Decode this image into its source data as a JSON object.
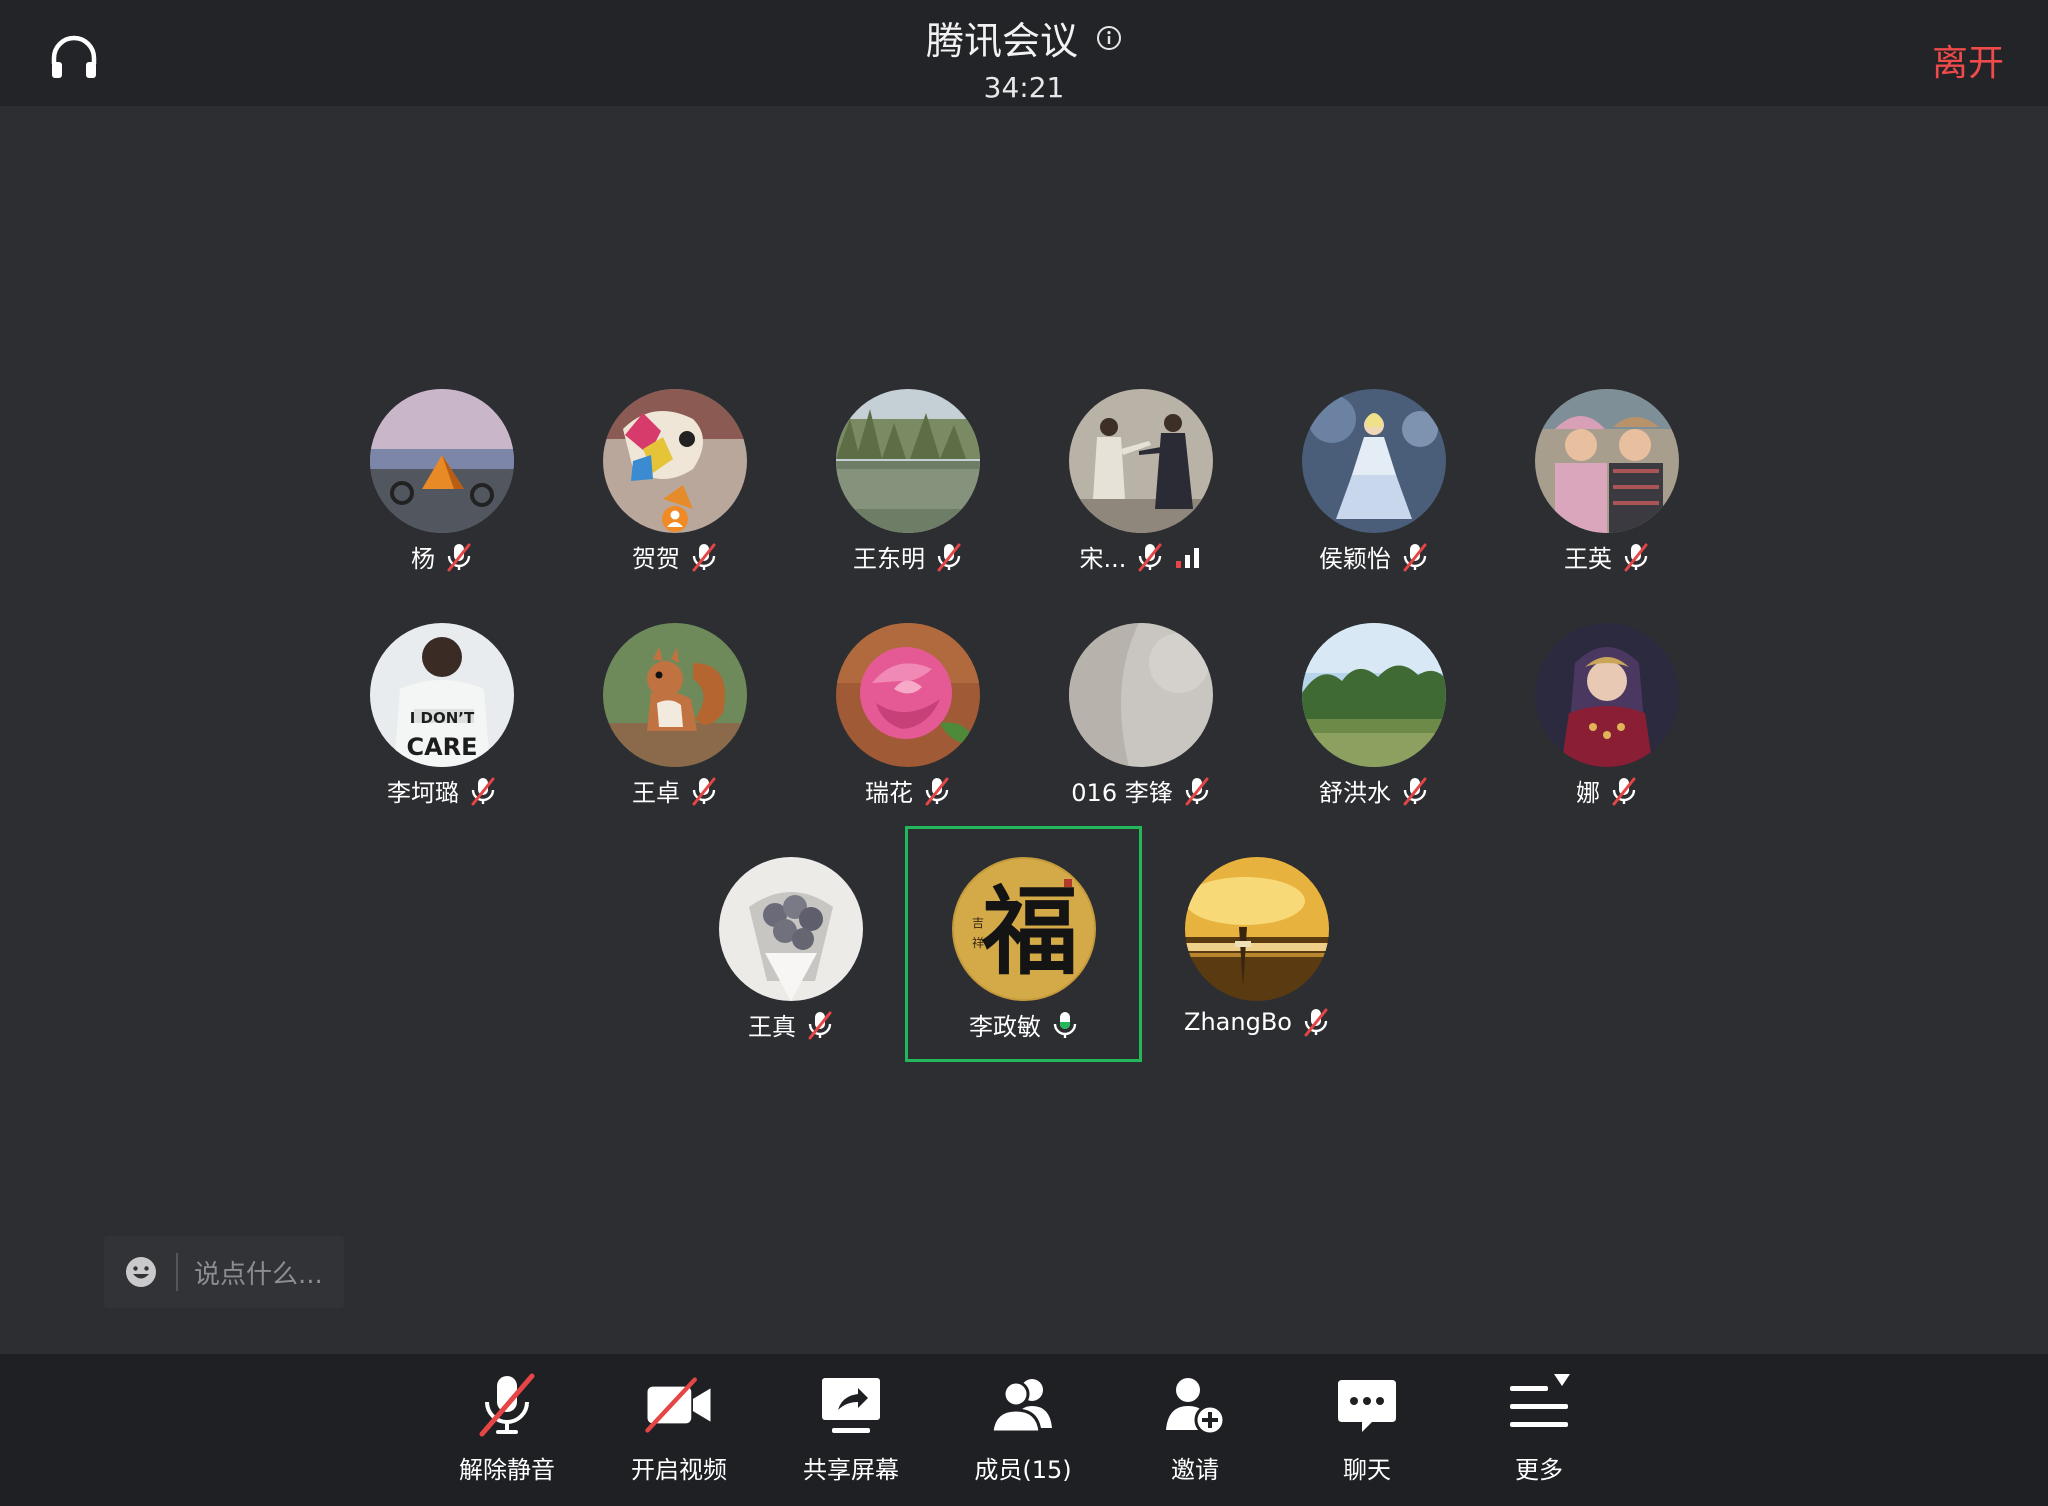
{
  "header": {
    "title": "腾讯会议",
    "timer": "34:21",
    "leave_label": "离开"
  },
  "participants": [
    {
      "name": "杨",
      "mic": "muted",
      "avatar": "camping"
    },
    {
      "name": "贺贺",
      "mic": "muted",
      "avatar": "toy",
      "host": true
    },
    {
      "name": "王东明",
      "mic": "muted",
      "avatar": "lake"
    },
    {
      "name": "宋...",
      "mic": "muted",
      "avatar": "taichi",
      "signal": true
    },
    {
      "name": "侯颖怡",
      "mic": "muted",
      "avatar": "princess"
    },
    {
      "name": "王英",
      "mic": "muted",
      "avatar": "kids"
    },
    {
      "name": "李坷璐",
      "mic": "muted",
      "avatar": "shirt"
    },
    {
      "name": "王卓",
      "mic": "muted",
      "avatar": "squirrel"
    },
    {
      "name": "瑞花",
      "mic": "muted",
      "avatar": "rose"
    },
    {
      "name": "016 李锋",
      "mic": "muted",
      "avatar": "blank"
    },
    {
      "name": "舒洪水",
      "mic": "muted",
      "avatar": "forest"
    },
    {
      "name": "娜",
      "mic": "muted",
      "avatar": "lady"
    },
    {
      "name": "王真",
      "mic": "muted",
      "avatar": "bouquet"
    },
    {
      "name": "李政敏",
      "mic": "active",
      "avatar": "fu",
      "speaking": true
    },
    {
      "name": "ZhangBo",
      "mic": "muted",
      "avatar": "golden"
    }
  ],
  "chat": {
    "placeholder": "说点什么..."
  },
  "toolbar": {
    "unmute": "解除静音",
    "video": "开启视频",
    "share": "共享屏幕",
    "members": "成员(15)",
    "invite": "邀请",
    "chat": "聊天",
    "more": "更多"
  },
  "colors": {
    "background": "#2d2e32",
    "top_bar": "#232427",
    "toolbar": "#1f2023",
    "leave": "#f04a4a",
    "active_speaker": "#22b85a",
    "muted": "#e64545"
  },
  "icons": {
    "headset": "headset-icon",
    "info": "info-icon",
    "muted_mic": "mic-muted-icon",
    "active_mic": "mic-active-icon",
    "signal": "signal-icon",
    "host": "host-badge-icon",
    "emoji": "emoji-icon"
  }
}
